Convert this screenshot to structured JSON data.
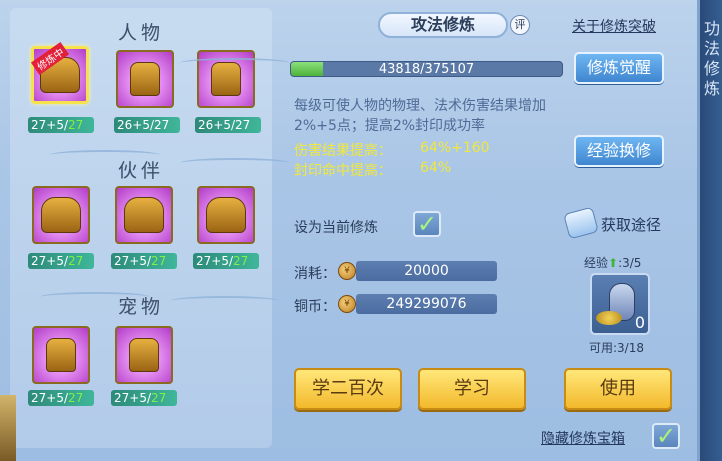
{
  "header": {
    "title": "攻法修炼",
    "eval_label": "评",
    "breakthrough_link": "关于修炼突破"
  },
  "progress": {
    "text": "43818/375107",
    "current": 43818,
    "max": 375107
  },
  "buttons": {
    "awaken": "修炼觉醒",
    "exchange": "经验换修",
    "learn_200": "学二百次",
    "learn": "学习",
    "use": "使用"
  },
  "description": "每级可使人物的物理、法术伤害结果增加2%+5点；提高2%封印成功率",
  "effects": [
    {
      "label": "伤害结果提高：",
      "value": "64%+160"
    },
    {
      "label": "封印命中提高：",
      "value": "64%"
    }
  ],
  "set_current": {
    "label": "设为当前修炼",
    "checked": true
  },
  "obtain": {
    "label": "获取途径"
  },
  "costs": {
    "consume_label": "消耗：",
    "consume_value": "20000",
    "copper_label": "铜币：",
    "copper_value": "249299076"
  },
  "item": {
    "exp_label": "经验",
    "exp_count": ":3/5",
    "count": "0",
    "available": "可用:3/18"
  },
  "hide_chest": {
    "label": "隐藏修炼宝箱",
    "checked": true
  },
  "sections": {
    "character": {
      "title": "人物",
      "slots": [
        {
          "level": "27+5/",
          "extra": "27",
          "tag": "修炼中",
          "icon": "character-attack-icon"
        },
        {
          "level": "26+5/27",
          "extra": "",
          "icon": "character-defense-icon"
        },
        {
          "level": "26+5/27",
          "extra": "",
          "icon": "character-magic-icon"
        }
      ]
    },
    "partner": {
      "title": "伙伴",
      "slots": [
        {
          "level": "27+5/",
          "extra": "27",
          "icon": "partner-attack-icon"
        },
        {
          "level": "27+5/",
          "extra": "27",
          "icon": "partner-defense-icon"
        },
        {
          "level": "27+5/",
          "extra": "27",
          "icon": "partner-magic-icon"
        }
      ]
    },
    "pet": {
      "title": "宠物",
      "slots": [
        {
          "level": "27+5/",
          "extra": "27",
          "icon": "pet-attack-icon"
        },
        {
          "level": "27+5/",
          "extra": "27",
          "icon": "pet-defense-icon"
        }
      ]
    }
  },
  "side_strip": "功法修炼"
}
